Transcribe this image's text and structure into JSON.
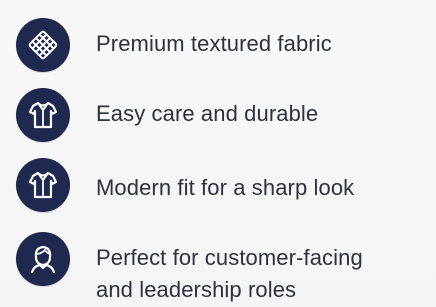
{
  "features": [
    {
      "icon": "fabric-texture-icon",
      "label": "Premium textured fabric"
    },
    {
      "icon": "shirt-icon",
      "label": "Easy care and durable"
    },
    {
      "icon": "shirt-icon",
      "label": "Modern fit for a sharp look"
    },
    {
      "icon": "person-icon",
      "label": "Perfect for customer-facing\nand leadership roles"
    }
  ],
  "colors": {
    "badge": "#1f2950",
    "text": "#2d3140",
    "background": "#f7f7f8"
  }
}
